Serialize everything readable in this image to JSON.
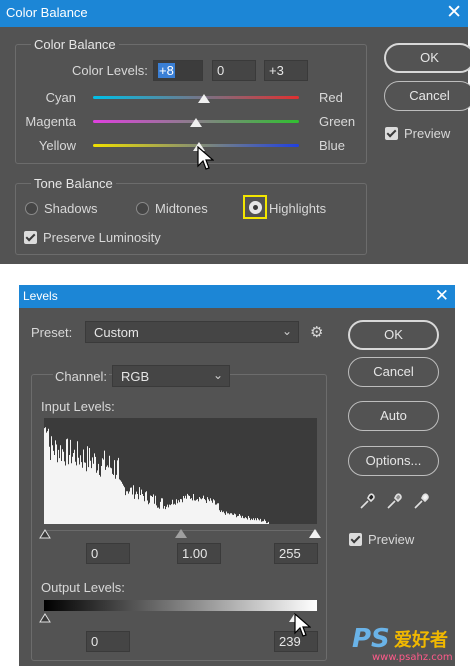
{
  "color_balance": {
    "title": "Color Balance",
    "close_glyph": "✕",
    "group_title": "Color Balance",
    "levels_label": "Color Levels:",
    "levels": [
      "+8",
      "0",
      "+3"
    ],
    "sliders": [
      {
        "left": "Cyan",
        "right": "Red",
        "value": 8,
        "colors": [
          "#00c0e8",
          "#e03030"
        ]
      },
      {
        "left": "Magenta",
        "right": "Green",
        "value": 0,
        "colors": [
          "#e040e0",
          "#30c030"
        ]
      },
      {
        "left": "Yellow",
        "right": "Blue",
        "value": 3,
        "colors": [
          "#f0e000",
          "#2040e0"
        ]
      }
    ],
    "tone_title": "Tone Balance",
    "tones": [
      "Shadows",
      "Midtones",
      "Highlights"
    ],
    "selected_tone": "Highlights",
    "preserve_label": "Preserve Luminosity",
    "preserve_checked": true,
    "ok_label": "OK",
    "cancel_label": "Cancel",
    "preview_label": "Preview",
    "preview_checked": true
  },
  "levels": {
    "title": "Levels",
    "close_glyph": "✕",
    "preset_label": "Preset:",
    "preset_value": "Custom",
    "channel_label": "Channel:",
    "channel_value": "RGB",
    "input_label": "Input Levels:",
    "input_values": [
      "0",
      "1.00",
      "255"
    ],
    "output_label": "Output Levels:",
    "output_values": [
      "0",
      "239"
    ],
    "buttons": {
      "ok": "OK",
      "cancel": "Cancel",
      "auto": "Auto",
      "options": "Options..."
    },
    "preview_label": "Preview",
    "preview_checked": true
  },
  "watermark": {
    "logo": "PS",
    "site_text": "爱好者",
    "url": "www.psahz.com"
  }
}
